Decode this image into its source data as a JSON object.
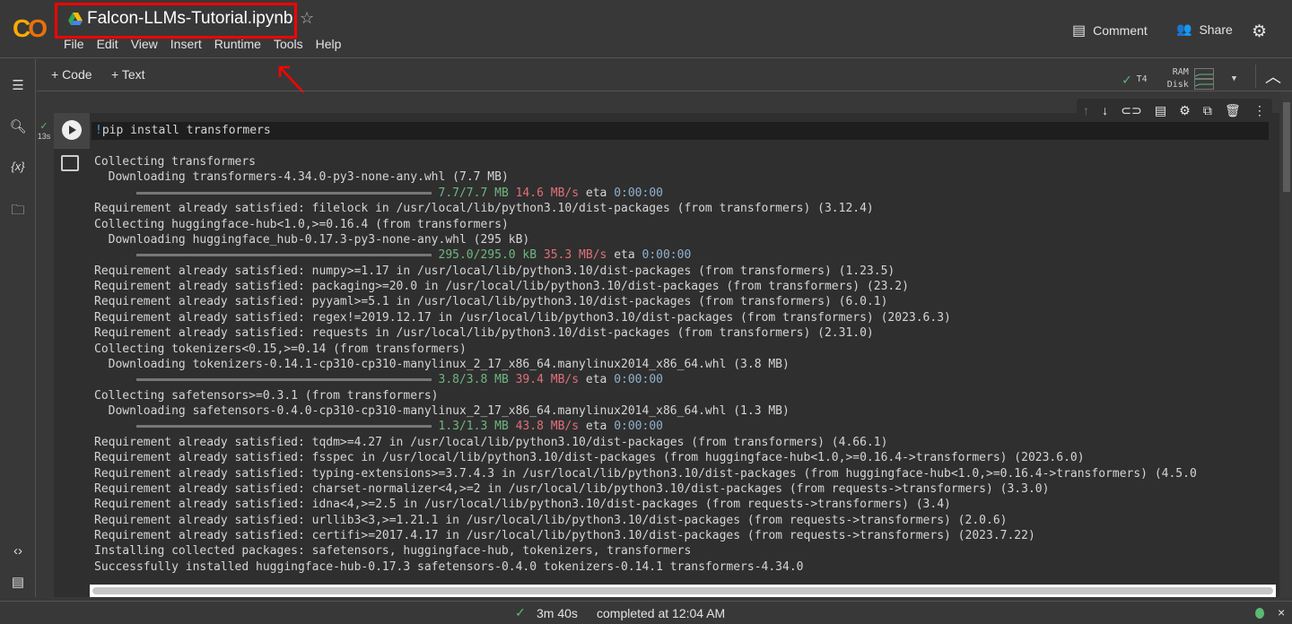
{
  "header": {
    "logo": "CO",
    "title": "Falcon-LLMs-Tutorial.ipynb",
    "menu": [
      "File",
      "Edit",
      "View",
      "Insert",
      "Runtime",
      "Tools",
      "Help"
    ],
    "comment": "Comment",
    "share": "Share"
  },
  "toolbar": {
    "add_code": "+ Code",
    "add_text": "+ Text",
    "runtime": "T4",
    "ram": "RAM",
    "disk": "Disk"
  },
  "cell": {
    "exec_time": "13s",
    "code_bang": "!",
    "code": "pip install transformers",
    "output": [
      {
        "text": "Collecting transformers"
      },
      {
        "text": "  Downloading transformers-4.34.0-py3-none-any.whl (7.7 MB)"
      },
      {
        "progress": {
          "done": "7.7/7.7 MB",
          "speed": "14.6 MB/s",
          "eta_label": "eta",
          "eta": "0:00:00"
        }
      },
      {
        "text": "Requirement already satisfied: filelock in /usr/local/lib/python3.10/dist-packages (from transformers) (3.12.4)"
      },
      {
        "text": "Collecting huggingface-hub<1.0,>=0.16.4 (from transformers)"
      },
      {
        "text": "  Downloading huggingface_hub-0.17.3-py3-none-any.whl (295 kB)"
      },
      {
        "progress": {
          "done": "295.0/295.0 kB",
          "speed": "35.3 MB/s",
          "eta_label": "eta",
          "eta": "0:00:00"
        }
      },
      {
        "text": "Requirement already satisfied: numpy>=1.17 in /usr/local/lib/python3.10/dist-packages (from transformers) (1.23.5)"
      },
      {
        "text": "Requirement already satisfied: packaging>=20.0 in /usr/local/lib/python3.10/dist-packages (from transformers) (23.2)"
      },
      {
        "text": "Requirement already satisfied: pyyaml>=5.1 in /usr/local/lib/python3.10/dist-packages (from transformers) (6.0.1)"
      },
      {
        "text": "Requirement already satisfied: regex!=2019.12.17 in /usr/local/lib/python3.10/dist-packages (from transformers) (2023.6.3)"
      },
      {
        "text": "Requirement already satisfied: requests in /usr/local/lib/python3.10/dist-packages (from transformers) (2.31.0)"
      },
      {
        "text": "Collecting tokenizers<0.15,>=0.14 (from transformers)"
      },
      {
        "text": "  Downloading tokenizers-0.14.1-cp310-cp310-manylinux_2_17_x86_64.manylinux2014_x86_64.whl (3.8 MB)"
      },
      {
        "progress": {
          "done": "3.8/3.8 MB",
          "speed": "39.4 MB/s",
          "eta_label": "eta",
          "eta": "0:00:00"
        }
      },
      {
        "text": "Collecting safetensors>=0.3.1 (from transformers)"
      },
      {
        "text": "  Downloading safetensors-0.4.0-cp310-cp310-manylinux_2_17_x86_64.manylinux2014_x86_64.whl (1.3 MB)"
      },
      {
        "progress": {
          "done": "1.3/1.3 MB",
          "speed": "43.8 MB/s",
          "eta_label": "eta",
          "eta": "0:00:00"
        }
      },
      {
        "text": "Requirement already satisfied: tqdm>=4.27 in /usr/local/lib/python3.10/dist-packages (from transformers) (4.66.1)"
      },
      {
        "text": "Requirement already satisfied: fsspec in /usr/local/lib/python3.10/dist-packages (from huggingface-hub<1.0,>=0.16.4->transformers) (2023.6.0)"
      },
      {
        "text": "Requirement already satisfied: typing-extensions>=3.7.4.3 in /usr/local/lib/python3.10/dist-packages (from huggingface-hub<1.0,>=0.16.4->transformers) (4.5.0"
      },
      {
        "text": "Requirement already satisfied: charset-normalizer<4,>=2 in /usr/local/lib/python3.10/dist-packages (from requests->transformers) (3.3.0)"
      },
      {
        "text": "Requirement already satisfied: idna<4,>=2.5 in /usr/local/lib/python3.10/dist-packages (from requests->transformers) (3.4)"
      },
      {
        "text": "Requirement already satisfied: urllib3<3,>=1.21.1 in /usr/local/lib/python3.10/dist-packages (from requests->transformers) (2.0.6)"
      },
      {
        "text": "Requirement already satisfied: certifi>=2017.4.17 in /usr/local/lib/python3.10/dist-packages (from requests->transformers) (2023.7.22)"
      },
      {
        "text": "Installing collected packages: safetensors, huggingface-hub, tokenizers, transformers"
      },
      {
        "text": "Successfully installed huggingface-hub-0.17.3 safetensors-0.4.0 tokenizers-0.14.1 transformers-4.34.0"
      }
    ]
  },
  "status": {
    "duration": "3m 40s",
    "completed": "completed at 12:04 AM"
  },
  "colors": {
    "accent_green": "#5bb974",
    "annotation_red": "#ff0000"
  }
}
